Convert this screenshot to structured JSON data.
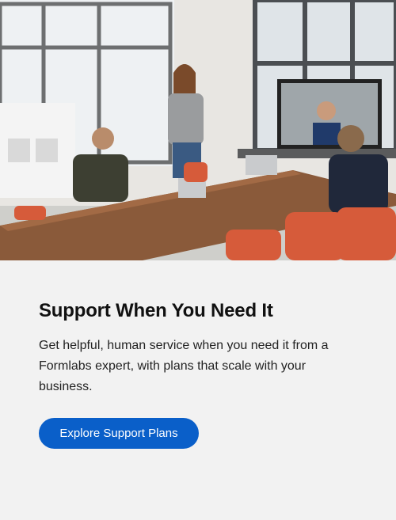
{
  "card": {
    "title": "Support When You Need It",
    "description": "Get helpful, human service when you need it from a Formlabs expert, with plans that scale with your business.",
    "cta_label": "Explore Support Plans"
  },
  "colors": {
    "background": "#f2f2f2",
    "button": "#0a5fc9",
    "button_text": "#ffffff",
    "title_text": "#111111"
  }
}
